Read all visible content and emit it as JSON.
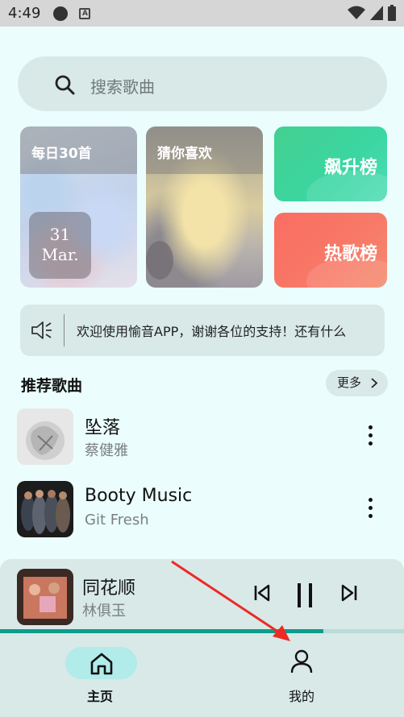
{
  "status_bar": {
    "time": "4:49"
  },
  "search": {
    "placeholder": "搜索歌曲"
  },
  "cards": {
    "daily": {
      "title": "每日30首",
      "day": "31",
      "month": "Mar."
    },
    "guess": {
      "title": "猜你喜欢"
    },
    "rising": {
      "title": "飙升榜"
    },
    "hot": {
      "title": "热歌榜"
    }
  },
  "notice": {
    "text": "欢迎使用愉音APP，谢谢各位的支持！还有什么"
  },
  "recommend": {
    "title": "推荐歌曲",
    "more_label": "更多",
    "songs": [
      {
        "title": "坠落",
        "artist": "蔡健雅"
      },
      {
        "title": "Booty Music",
        "artist": "Git Fresh"
      }
    ]
  },
  "player": {
    "title": "同花顺",
    "artist": "林俱玉",
    "progress": 0.8
  },
  "nav": {
    "home": "主页",
    "me": "我的"
  },
  "colors": {
    "accent": "#0e9c8c",
    "background": "#ebfefd",
    "annotation_arrow": "#ee2a24"
  }
}
